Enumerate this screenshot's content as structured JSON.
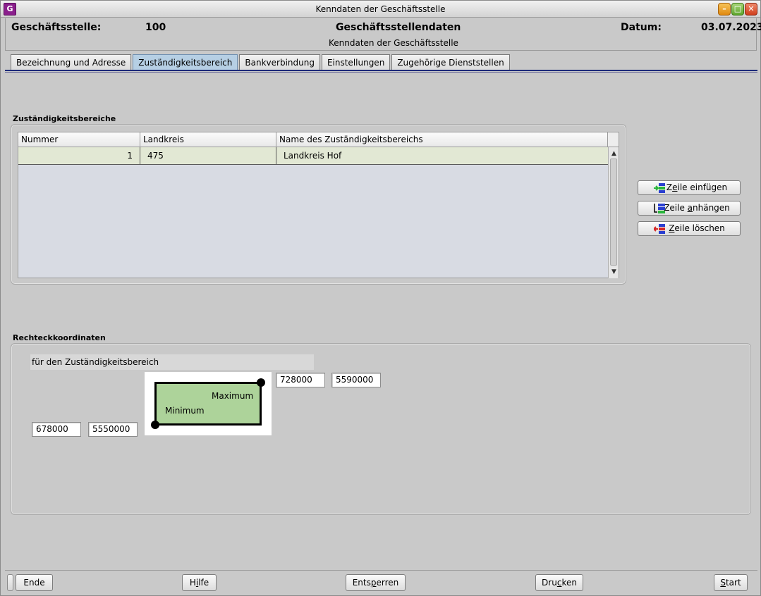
{
  "window": {
    "title": "Kenndaten der Geschäftsstelle",
    "app_icon_letter": "G",
    "min_symbol": "–",
    "max_symbol": "□",
    "close_symbol": "✕"
  },
  "header": {
    "office_label": "Geschäftsstelle:",
    "office_value": "100",
    "center_title": "Geschäftsstellendaten",
    "center_subtitle": "Kenndaten der Geschäftsstelle",
    "date_label": "Datum:",
    "date_value": "03.07.2023"
  },
  "tabs": [
    {
      "label": "Bezeichnung und Adresse",
      "active": false
    },
    {
      "label": "Zuständigkeitsbereich",
      "active": true
    },
    {
      "label": "Bankverbindung",
      "active": false
    },
    {
      "label": "Einstellungen",
      "active": false
    },
    {
      "label": "Zugehörige Dienststellen",
      "active": false
    }
  ],
  "zustaendigkeit": {
    "section_title": "Zuständigkeitsbereiche",
    "columns": [
      "Nummer",
      "Landkreis",
      "Name des Zuständigkeitsbereichs"
    ],
    "rows": [
      {
        "nummer": "1",
        "landkreis": "475",
        "name": "Landkreis Hof"
      }
    ],
    "scroll_up": "▲",
    "scroll_down": "▼"
  },
  "side_buttons": {
    "insert": {
      "pre": "Z",
      "mnemonic": "e",
      "post": "ile einfügen"
    },
    "append": {
      "pre": "Zeile ",
      "mnemonic": "a",
      "post": "nhängen"
    },
    "delete": {
      "pre": "",
      "mnemonic": "Z",
      "post": "eile löschen"
    }
  },
  "coordinates": {
    "section_title": "Rechteckkoordinaten",
    "subtitle": "für den Zuständigkeitsbereich",
    "max_label": "Maximum",
    "min_label": "Minimum",
    "max_x": "728000",
    "max_y": "5590000",
    "min_x": "678000",
    "min_y": "5550000"
  },
  "footer": {
    "ende": "Ende",
    "hilfe": {
      "pre": "H",
      "mnemonic": "i",
      "post": "lfe"
    },
    "entsperren": {
      "pre": "Ents",
      "mnemonic": "p",
      "post": "erren"
    },
    "drucken": {
      "pre": "Dru",
      "mnemonic": "c",
      "post": "ken"
    },
    "start": {
      "pre": "",
      "mnemonic": "S",
      "post": "tart"
    }
  },
  "colors": {
    "active_tab": "#b6cfe4",
    "selected_row": "#e2e8d4",
    "rect_fill": "#add39a",
    "tab_line": "#1c2a7a"
  }
}
